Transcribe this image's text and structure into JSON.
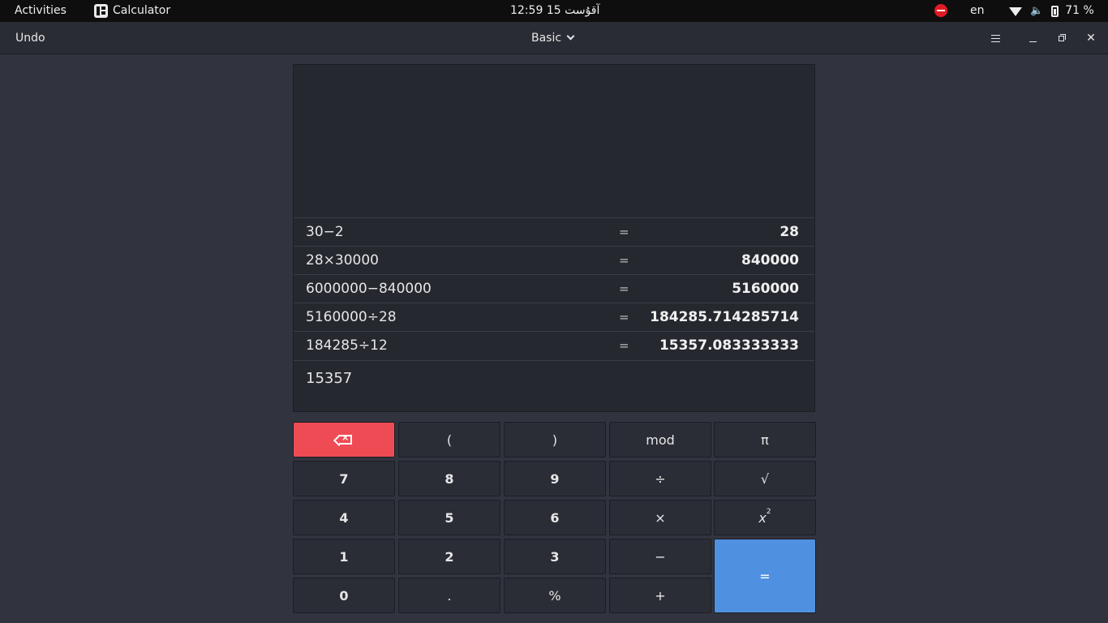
{
  "topbar": {
    "activities": "Activities",
    "app_name": "Calculator",
    "clock": "آقۇست 15  12:59",
    "language": "en",
    "battery": "71 %"
  },
  "headerbar": {
    "undo": "Undo",
    "mode": "Basic"
  },
  "history": [
    {
      "expr": "30−2",
      "eq": "=",
      "result": "28"
    },
    {
      "expr": "28×30000",
      "eq": "=",
      "result": "840000"
    },
    {
      "expr": "6000000−840000",
      "eq": "=",
      "result": "5160000"
    },
    {
      "expr": "5160000÷28",
      "eq": "=",
      "result": "184285.714285714"
    },
    {
      "expr": "184285÷12",
      "eq": "=",
      "result": "15357.083333333"
    }
  ],
  "entry": "15357",
  "keys": {
    "lparen": "(",
    "rparen": ")",
    "mod": "mod",
    "pi": "π",
    "seven": "7",
    "eight": "8",
    "nine": "9",
    "divide": "÷",
    "sqrt": "√",
    "four": "4",
    "five": "5",
    "six": "6",
    "multiply": "×",
    "square_base": "x",
    "square_exp": "2",
    "one": "1",
    "two": "2",
    "three": "3",
    "subtract": "−",
    "equals": "=",
    "zero": "0",
    "point": ".",
    "percent": "%",
    "add": "+"
  },
  "colors": {
    "backspace": "#ef4b54",
    "equals": "#4f91e0"
  },
  "icons": [
    "backspace-icon",
    "chevron-down-icon",
    "menu-icon",
    "minimize-icon",
    "maximize-icon",
    "close-icon",
    "wifi-icon",
    "volume-icon",
    "battery-icon",
    "do-not-disturb-icon"
  ]
}
